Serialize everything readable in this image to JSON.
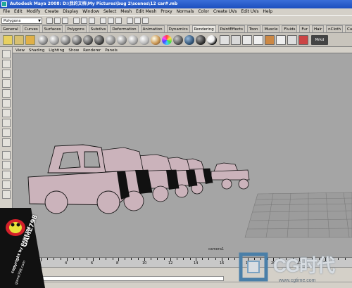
{
  "window": {
    "title": "Autodesk Maya 2008: D:\\我的文档\\My Pictures\\bug 2\\scenes\\12 car#.mb"
  },
  "menubar": {
    "items": [
      "File",
      "Edit",
      "Modify",
      "Create",
      "Display",
      "Window",
      "Select",
      "Mesh",
      "Edit Mesh",
      "Proxy",
      "Normals",
      "Color",
      "Create UVs",
      "Edit UVs",
      "Help"
    ]
  },
  "statusline": {
    "mode": "Polygons"
  },
  "shelf_tabs": {
    "items": [
      "General",
      "Curves",
      "Surfaces",
      "Polygons",
      "Subdivs",
      "Deformation",
      "Animation",
      "Dynamics",
      "Rendering",
      "PaintEffects",
      "Toon",
      "Muscle",
      "Fluids",
      "Fur",
      "Hair",
      "nCloth",
      "Custom"
    ],
    "active": "Rendering"
  },
  "shelf": {
    "end_label": "Mrkd"
  },
  "panel_menu": {
    "items": [
      "View",
      "Shading",
      "Lighting",
      "Show",
      "Renderer",
      "Panels"
    ]
  },
  "viewport": {
    "camera_label": "camera1",
    "background_color": "#a5a5a5",
    "car_color": "#cbb3bb"
  },
  "timeline": {
    "ticks": [
      "2",
      "4",
      "6",
      "8",
      "10",
      "12",
      "14",
      "16",
      "18",
      "20",
      "22",
      "24"
    ]
  },
  "badge": {
    "brand": "GAME798",
    "line1": "copyright by GAME798",
    "line2": "game798.com"
  },
  "watermark": {
    "brand": "CG时代",
    "url": "www.cgtime.com"
  }
}
